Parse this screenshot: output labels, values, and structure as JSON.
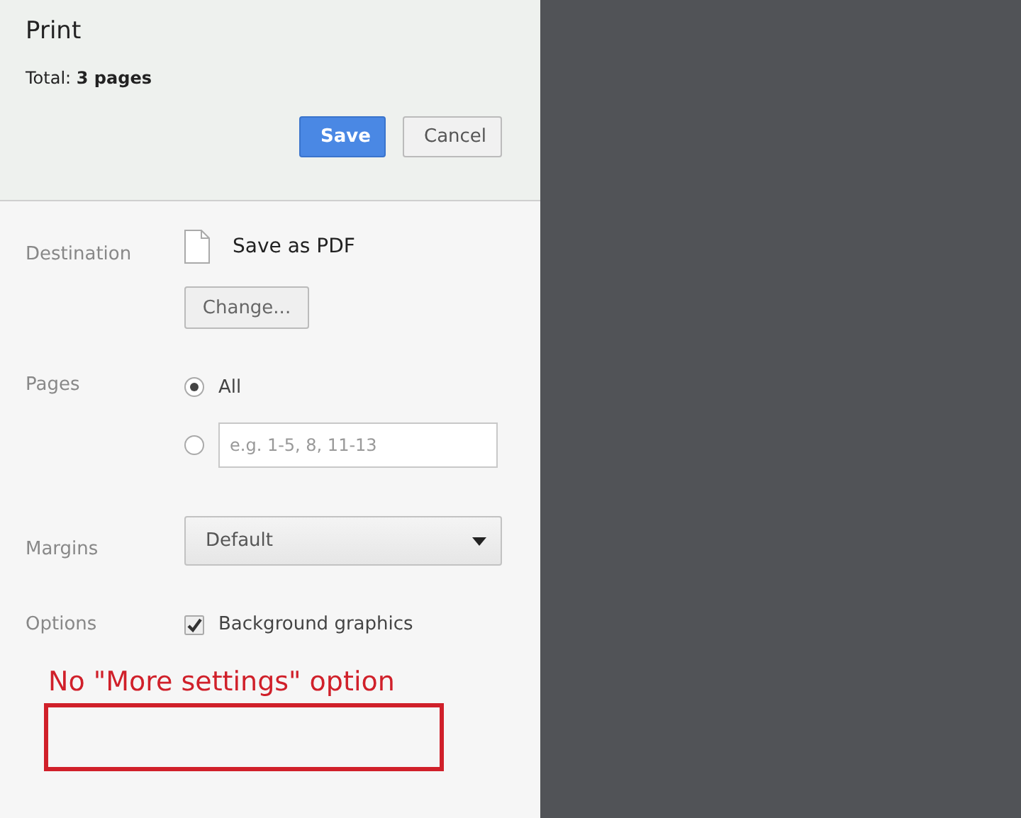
{
  "dialog": {
    "title": "Print",
    "total": "Total: **3 pages**",
    "buttons": [
      {
        "label": "Save",
        "kind": "primary"
      },
      {
        "label": "Cancel",
        "kind": "secondary"
      }
    ]
  },
  "destination": {
    "label": "Destination",
    "value": "Save as PDF",
    "button": "Change..."
  },
  "pages": {
    "label": "Pages",
    "options": [
      {
        "kind": "all",
        "label": "All",
        "selected": true
      },
      {
        "kind": "range",
        "placeholder": "e.g. 1-5, 8, 11-13",
        "selected": false
      }
    ]
  },
  "margins": {
    "label": "Margins",
    "value": "Default"
  },
  "options": {
    "label": "Options",
    "items": [
      {
        "label": "Background graphics",
        "checked": true
      }
    ]
  },
  "annotation": {
    "text": "No \"More settings\" option"
  }
}
